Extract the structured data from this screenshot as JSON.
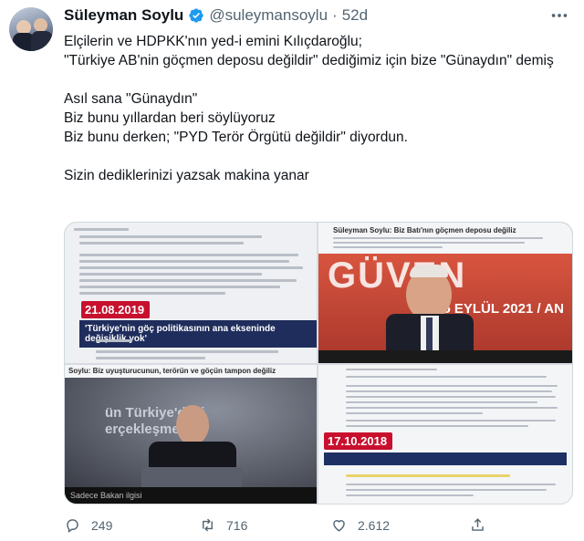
{
  "tweet": {
    "name": "Süleyman Soylu",
    "handle": "@suleymansoylu",
    "separator": "·",
    "time": "52d",
    "paragraphs": [
      "Elçilerin ve HDPKK'nın yed-i emini Kılıçdaroğlu;\n\"Türkiye AB'nin göçmen deposu değildir\" dediğimiz için bize \"Günaydın\" demiş",
      "Asıl sana \"Günaydın\"\nBiz bunu yıllardan beri söylüyoruz\nBiz bunu derken; \"PYD Terör Örgütü değildir\" diyordun.",
      "Sizin dediklerinizi yazsak makina yanar"
    ]
  },
  "media": {
    "tile_a": {
      "date": "21.08.2019",
      "quote": "'Türkiye'nin göç politikasının ana ekseninde değişiklik yok'"
    },
    "tile_b": {
      "headline": "Süleyman Soylu: Biz Batı'nın göçmen deposu değiliz",
      "banner_big": "GÜVEN",
      "banner_sub": "15 EYLÜL 2021 / AN"
    },
    "tile_c": {
      "headline": "Soylu: Biz uyuşturucunun, terörün ve göçün tampon değiliz",
      "screen_text": "ün Türkiye'deki\nerçekleşmetedir",
      "footer": "Sadece Bakan ilgisi"
    },
    "tile_d": {
      "date": "17.10.2018"
    }
  },
  "actions": {
    "replies": "249",
    "retweets": "716",
    "likes": "2.612"
  },
  "colors": {
    "verified": "#1d9bf0",
    "muted": "#536471",
    "date_badge": "#c8102e"
  },
  "icons": [
    "verified-badge-icon",
    "more-icon",
    "reply-icon",
    "retweet-icon",
    "like-icon",
    "share-icon"
  ]
}
